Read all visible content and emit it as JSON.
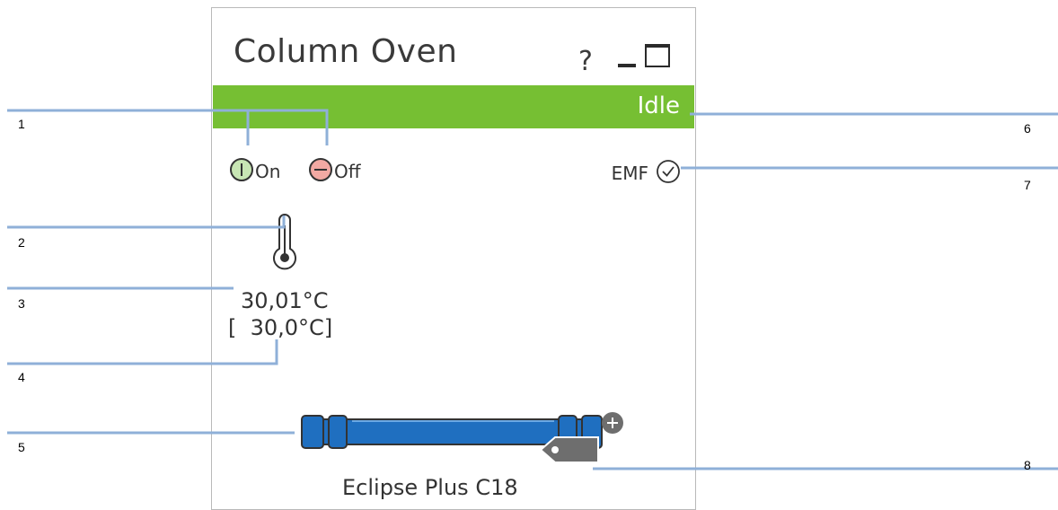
{
  "panel": {
    "title": "Column Oven",
    "help_label": "?",
    "status": "Idle",
    "on_label": "On",
    "off_label": "Off",
    "emf_label": "EMF",
    "actual_temperature": "30,01°C",
    "setpoint_temperature": "[  30,0°C]",
    "column_name": "Eclipse Plus C18"
  },
  "colors": {
    "status_ok": "#76bf33",
    "on_button": "#c8e6b4",
    "off_button": "#f2a9a3",
    "column_blue": "#1f6fc0",
    "callout_line": "#8fb0d8"
  },
  "icons": [
    "help-icon",
    "minimize-icon",
    "maximize-icon",
    "on-icon",
    "off-icon",
    "check-icon",
    "thermometer-icon",
    "column-icon",
    "tag-icon",
    "plus-icon"
  ],
  "callouts": {
    "c1": "1",
    "c2": "2",
    "c3": "3",
    "c4": "4",
    "c5": "5",
    "c6": "6",
    "c7": "7",
    "c8": "8"
  }
}
